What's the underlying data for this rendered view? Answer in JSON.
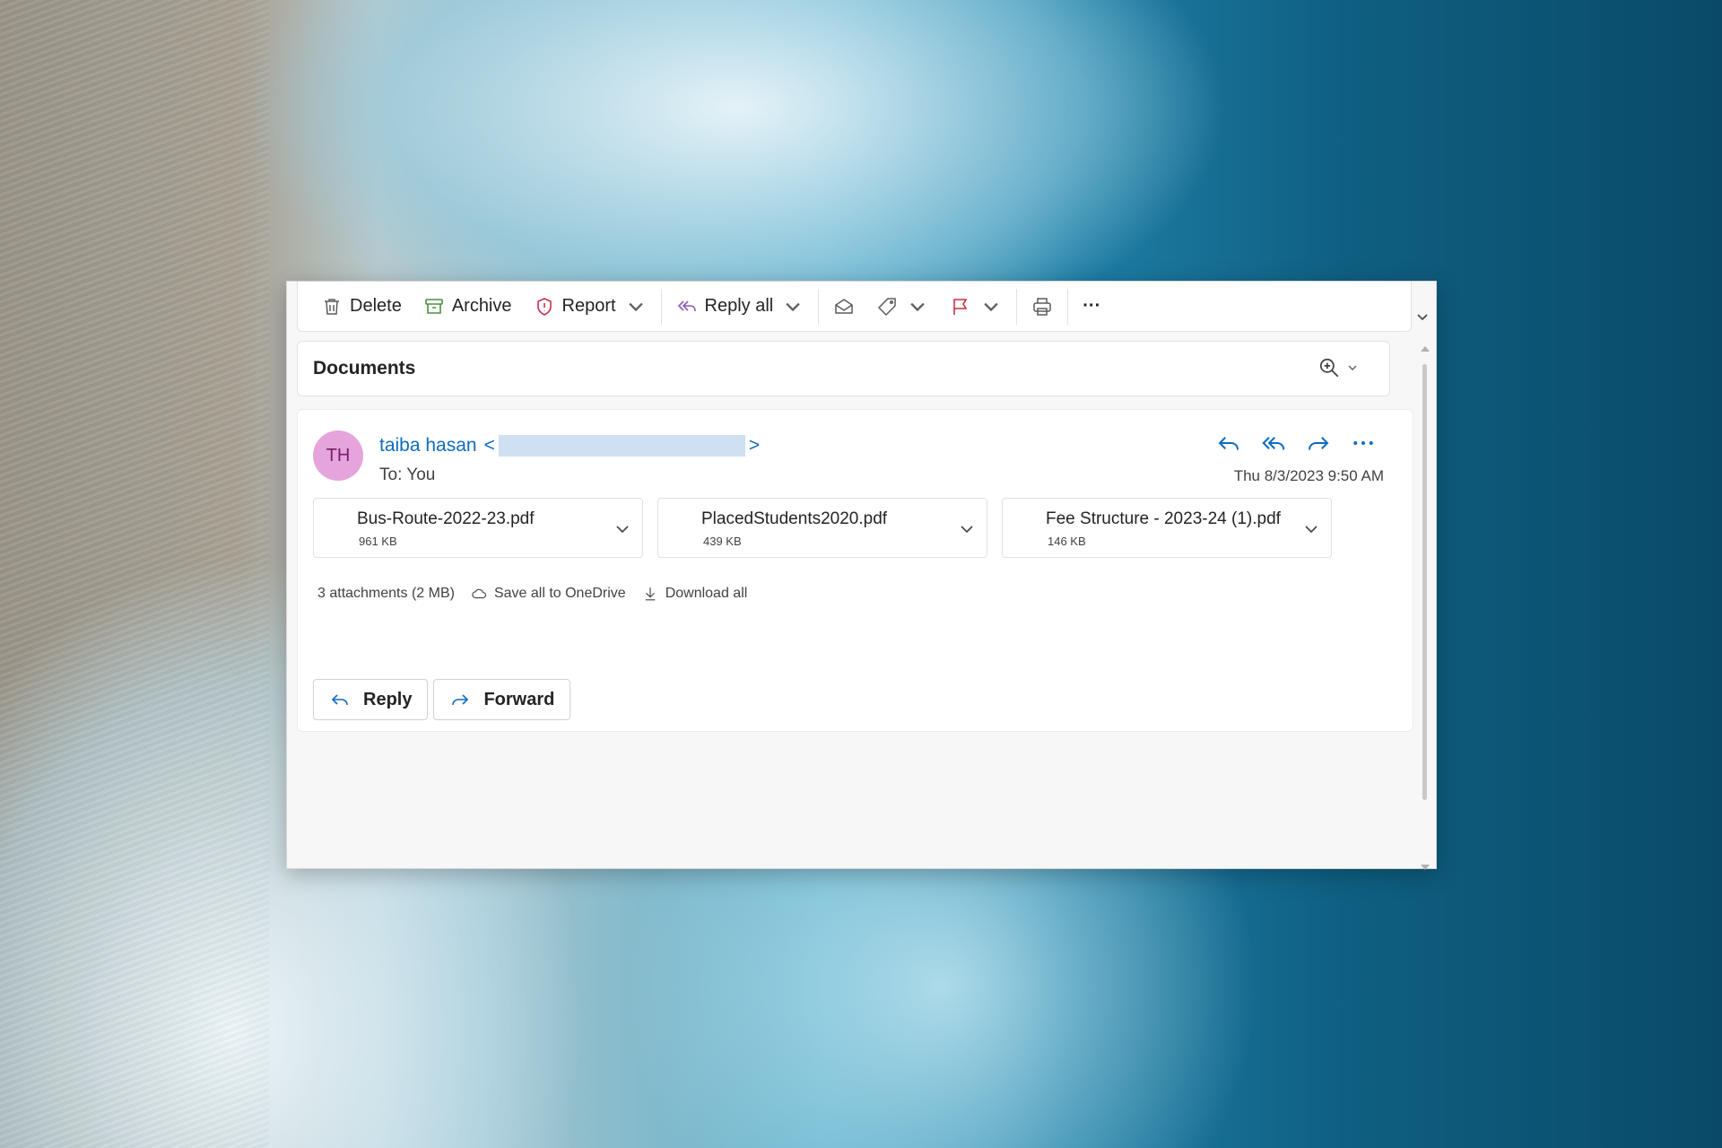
{
  "toolbar": {
    "delete": "Delete",
    "archive": "Archive",
    "report": "Report",
    "reply_all": "Reply all",
    "more": "···"
  },
  "message": {
    "subject": "Documents",
    "avatar_initials": "TH",
    "sender_name": "taiba hasan",
    "sender_open": "<",
    "sender_close": ">",
    "to_label": "To:",
    "to_value": "You",
    "datetime": "Thu 8/3/2023 9:50 AM"
  },
  "attachments": [
    {
      "name": "Bus-Route-2022-23.pdf",
      "size": "961 KB"
    },
    {
      "name": "PlacedStudents2020.pdf",
      "size": "439 KB"
    },
    {
      "name": "Fee Structure - 2023-24 (1).pdf",
      "size": "146 KB"
    }
  ],
  "attachment_summary": {
    "count_text": "3 attachments (2 MB)",
    "save_all": "Save all to OneDrive",
    "download_all": "Download all"
  },
  "actions": {
    "reply": "Reply",
    "forward": "Forward"
  },
  "colors": {
    "accent_blue": "#0f6cbd",
    "avatar_bg": "#e6a4dc",
    "archive_green": "#4a8f3c",
    "report_red": "#c4314b",
    "reply_all_purple": "#8a5bb7",
    "flag_red": "#c4314b"
  }
}
